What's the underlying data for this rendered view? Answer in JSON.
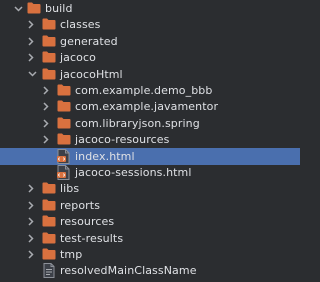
{
  "colors": {
    "background": "#2b2d30",
    "folder": "#d9713f",
    "selection": "#4a6fae",
    "text": "#dfe1e5",
    "arrow": "#a8abb0"
  },
  "tree": [
    {
      "label": "build",
      "expanded": true,
      "icon": "folder-icon"
    },
    {
      "label": "classes",
      "expanded": false,
      "icon": "folder-icon"
    },
    {
      "label": "generated",
      "expanded": false,
      "icon": "folder-icon"
    },
    {
      "label": "jacoco",
      "expanded": false,
      "icon": "folder-icon"
    },
    {
      "label": "jacocoHtml",
      "expanded": true,
      "icon": "folder-icon"
    },
    {
      "label": "com.example.demo_bbb",
      "expanded": false,
      "icon": "folder-icon"
    },
    {
      "label": "com.example.javamentor",
      "expanded": false,
      "icon": "folder-icon"
    },
    {
      "label": "com.libraryjson.spring",
      "expanded": false,
      "icon": "folder-icon"
    },
    {
      "label": "jacoco-resources",
      "expanded": false,
      "icon": "folder-icon"
    },
    {
      "label": "index.html",
      "icon": "html-file-icon",
      "selected": true
    },
    {
      "label": "jacoco-sessions.html",
      "icon": "html-file-icon"
    },
    {
      "label": "libs",
      "expanded": false,
      "icon": "folder-icon"
    },
    {
      "label": "reports",
      "expanded": false,
      "icon": "folder-icon"
    },
    {
      "label": "resources",
      "expanded": false,
      "icon": "folder-icon"
    },
    {
      "label": "test-results",
      "expanded": false,
      "icon": "folder-icon"
    },
    {
      "label": "tmp",
      "expanded": false,
      "icon": "folder-icon"
    },
    {
      "label": "resolvedMainClassName",
      "icon": "text-file-icon"
    }
  ]
}
